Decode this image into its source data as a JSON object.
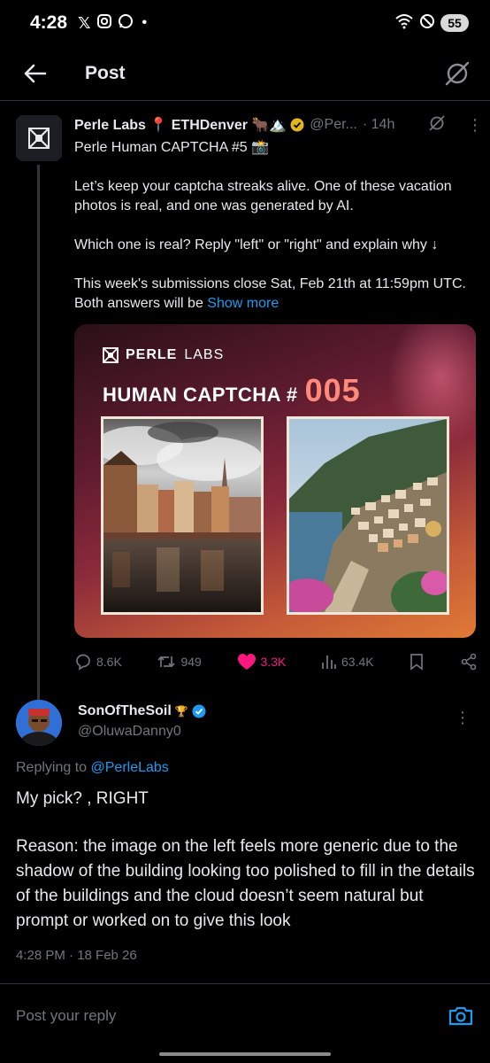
{
  "status_bar": {
    "time": "4:28",
    "battery": "55"
  },
  "header": {
    "title": "Post"
  },
  "tweet": {
    "author_name": "Perle Labs 📍 ETHDenver 🐂🏔️",
    "author_handle": "@Per...",
    "time": "· 14h",
    "line1": "Perle Human CAPTCHA #5 📸",
    "para1": "Let’s keep your captcha streaks alive. One of these vacation photos is real, and one was generated by AI.",
    "para2": "Which one is real? Reply \"left\" or \"right\" and explain why ↓",
    "para3": "This week's submissions close Sat, Feb 21th at 11:59pm UTC. Both answers will be",
    "show_more": "Show more",
    "card": {
      "logo_bold": "PERLE",
      "logo_light": "LABS",
      "title": "HUMAN CAPTCHA #",
      "number": "005"
    },
    "stats": {
      "replies": "8.6K",
      "reposts": "949",
      "likes": "3.3K",
      "views": "63.4K"
    }
  },
  "reply": {
    "name": "SonOfTheSoil",
    "handle": "@OluwaDanny0",
    "replying_prefix": "Replying to",
    "replying_handle": "@PerleLabs",
    "text1": "My pick? , RIGHT",
    "text2": "Reason: the image on the left feels more generic due to the shadow of the building looking too polished to fill in the details of the buildings and the cloud doesn’t seem natural but prompt or worked on to give this look",
    "timestamp": "4:28 PM · 18 Feb 26"
  },
  "composer": {
    "placeholder": "Post your reply"
  },
  "colors": {
    "accent": "#1d9bf0",
    "like": "#f91880",
    "muted": "#71767b",
    "text": "#e7e9ea"
  }
}
